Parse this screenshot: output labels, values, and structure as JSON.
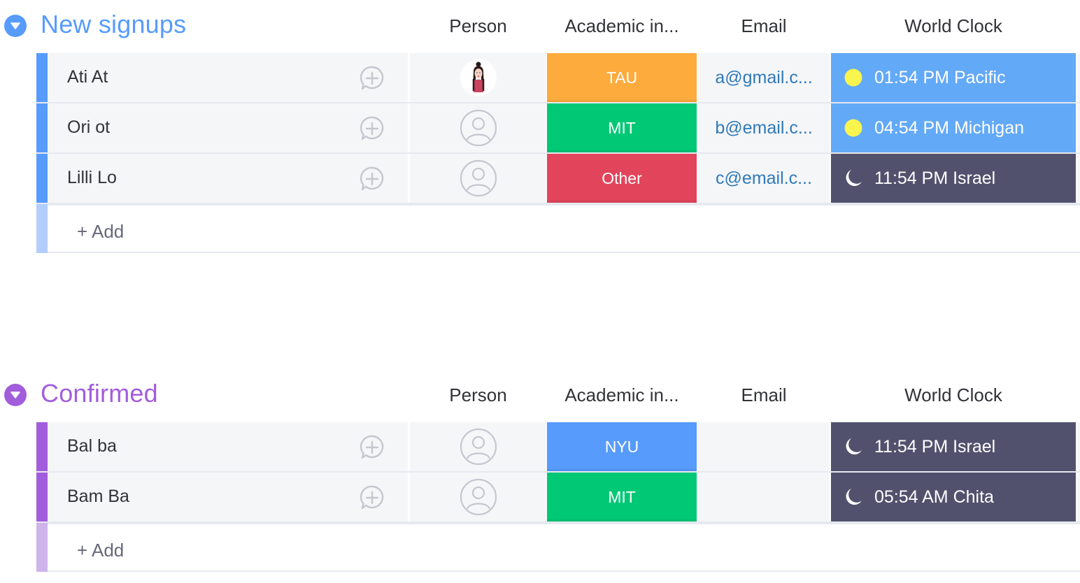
{
  "columns": {
    "person": "Person",
    "academic": "Academic in...",
    "email": "Email",
    "clock": "World Clock"
  },
  "groups": [
    {
      "title": "New signups",
      "color": "#579bfc",
      "add_strip_color": "#b3cefc",
      "add_label": "+ Add",
      "rows": [
        {
          "name": "Ati At",
          "person": "avatar-photo",
          "academic": "TAU",
          "academic_color": "#fdab3d",
          "email": "a@gmail.c...",
          "clock_icon": "sun-icon",
          "clock": "01:54 PM Pacific",
          "clock_bg": "#62a9f7"
        },
        {
          "name": "Ori ot",
          "person": "empty-person",
          "academic": "MIT",
          "academic_color": "#00c875",
          "email": "b@email.c...",
          "clock_icon": "sun-icon",
          "clock": "04:54 PM Michigan",
          "clock_bg": "#62a9f7"
        },
        {
          "name": "Lilli Lo",
          "person": "empty-person",
          "academic": "Other",
          "academic_color": "#e2445c",
          "email": "c@email.c...",
          "clock_icon": "moon-icon",
          "clock": "11:54 PM Israel",
          "clock_bg": "#52516d"
        }
      ]
    },
    {
      "title": "Confirmed",
      "color": "#a25ddc",
      "add_strip_color": "#cdb4eb",
      "add_label": "+ Add",
      "rows": [
        {
          "name": "Bal ba",
          "person": "empty-person",
          "academic": "NYU",
          "academic_color": "#579bfc",
          "email": "",
          "clock_icon": "moon-icon",
          "clock": "11:54 PM Israel",
          "clock_bg": "#52516d"
        },
        {
          "name": "Bam Ba",
          "person": "empty-person",
          "academic": "MIT",
          "academic_color": "#00c875",
          "email": "",
          "clock_icon": "moon-icon",
          "clock": "05:54 AM Chita",
          "clock_bg": "#52516d"
        }
      ]
    }
  ]
}
